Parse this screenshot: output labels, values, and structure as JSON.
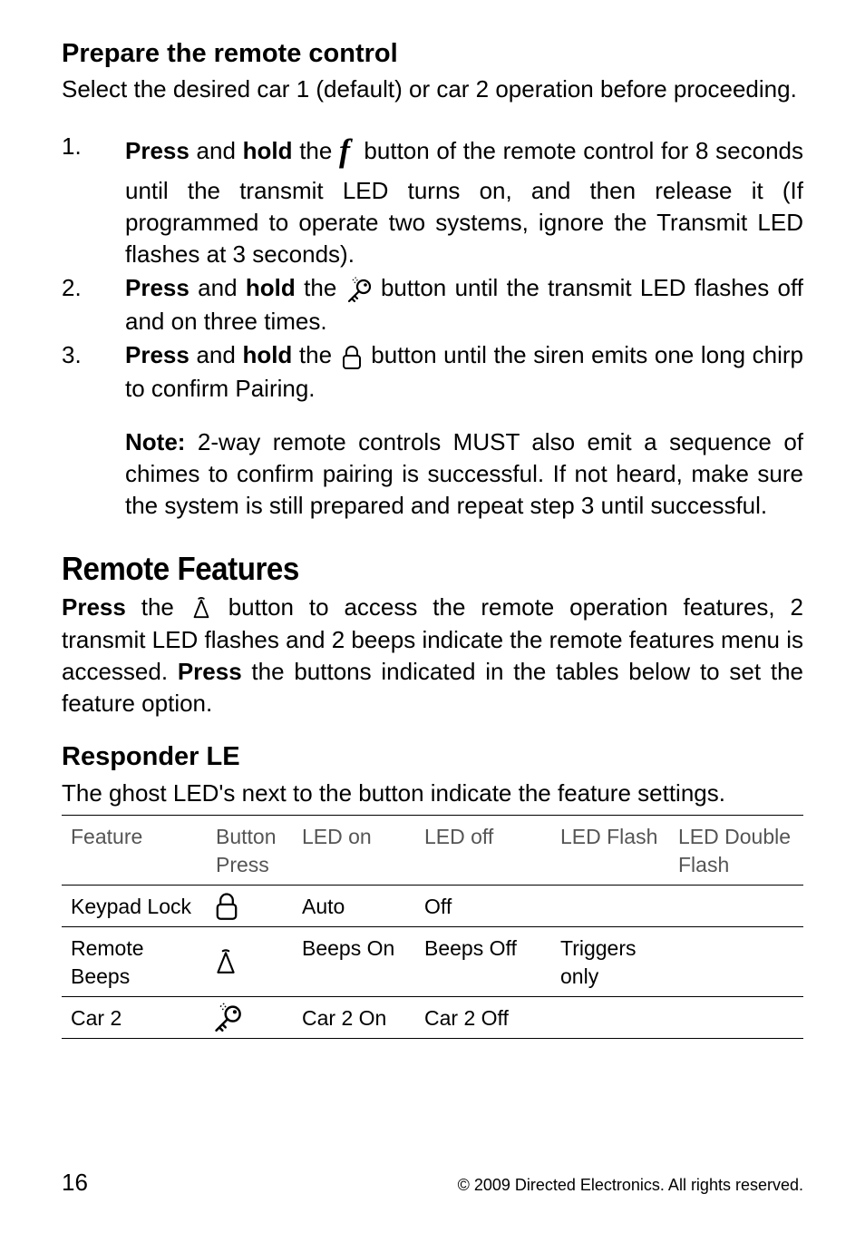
{
  "section1": {
    "heading": "Prepare the remote control",
    "intro": "Select the desired car 1 (default) or car 2 operation before proceeding.",
    "steps": [
      {
        "pre": "Press",
        "mid1": " and ",
        "hold": "hold",
        "mid2": " the ",
        "icon": "f",
        "post": " button of the remote control for 8 seconds until the transmit LED turns on, and then release it (If programmed to operate two systems, ignore the Transmit LED flashes at 3 seconds)."
      },
      {
        "pre": "Press",
        "mid1": " and ",
        "hold": "hold",
        "mid2": " the ",
        "icon": "key",
        "post": " button until the transmit LED flashes off and on three times."
      },
      {
        "pre": "Press",
        "mid1": " and ",
        "hold": "hold",
        "mid2": " the ",
        "icon": "lock",
        "post": " button until the siren emits one long chirp to confirm Pairing."
      }
    ],
    "note_label": "Note:",
    "note_text": " 2-way remote controls MUST also emit a sequence of chimes to confirm pairing is successful. If not heard, make sure the system is still prepared and repeat step 3 until successful."
  },
  "section2": {
    "heading": "Remote Features",
    "para_pre": "Press",
    "para_mid1": " the ",
    "para_icon": "aux",
    "para_mid2": " button to access the remote operation features, 2 transmit LED flashes and 2 beeps indicate the remote features menu is accessed. ",
    "para_press2": "Press",
    "para_post": " the buttons indicated in the tables below to set the feature option."
  },
  "section3": {
    "heading": "Responder LE",
    "intro": "The ghost LED's next to the button indicate the feature settings.",
    "headers": [
      "Feature",
      "Button Press",
      "LED on",
      "LED off",
      "LED Flash",
      "LED Double Flash"
    ],
    "rows": [
      {
        "feature": "Keypad Lock",
        "icon": "lock",
        "led_on": "Auto",
        "led_off": "Off",
        "led_flash": "",
        "led_dbl": ""
      },
      {
        "feature": "Remote Beeps",
        "icon": "aux",
        "led_on": "Beeps On",
        "led_off": "Beeps Off",
        "led_flash": "Triggers only",
        "led_dbl": ""
      },
      {
        "feature": "Car 2",
        "icon": "key",
        "led_on": "Car 2 On",
        "led_off": "Car 2 Off",
        "led_flash": "",
        "led_dbl": ""
      }
    ]
  },
  "footer": {
    "page": "16",
    "copyright": "© 2009 Directed Electronics. All rights reserved."
  }
}
